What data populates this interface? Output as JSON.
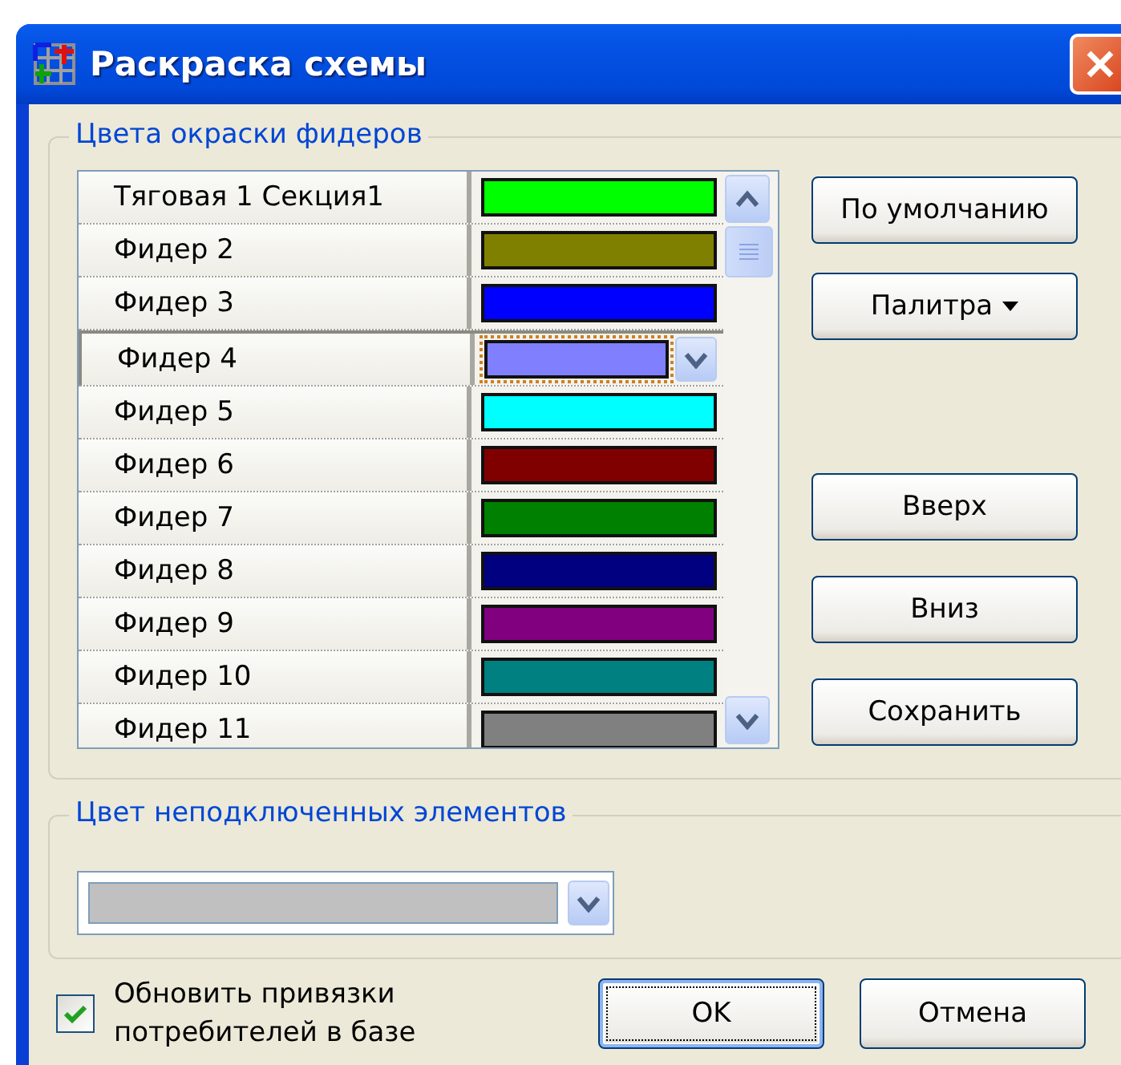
{
  "window": {
    "title": "Раскраска схемы"
  },
  "feeder_group": {
    "title": "Цвета окраски фидеров",
    "rows": [
      {
        "name": "Тяговая 1 Секция1",
        "color": "#00ff00",
        "selected": false
      },
      {
        "name": "Фидер 2",
        "color": "#808000",
        "selected": false
      },
      {
        "name": "Фидер 3",
        "color": "#0000ff",
        "selected": false
      },
      {
        "name": "Фидер 4",
        "color": "#8080ff",
        "selected": true
      },
      {
        "name": "Фидер 5",
        "color": "#00ffff",
        "selected": false
      },
      {
        "name": "Фидер 6",
        "color": "#800000",
        "selected": false
      },
      {
        "name": "Фидер 7",
        "color": "#008000",
        "selected": false
      },
      {
        "name": "Фидер 8",
        "color": "#000080",
        "selected": false
      },
      {
        "name": "Фидер 9",
        "color": "#800080",
        "selected": false
      },
      {
        "name": "Фидер 10",
        "color": "#008080",
        "selected": false
      },
      {
        "name": "Фидер 11",
        "color": "#808080",
        "selected": false
      }
    ],
    "buttons": [
      {
        "label": "По умолчанию",
        "kind": "plain"
      },
      {
        "label": "Палитра",
        "kind": "menu"
      },
      {
        "label": "Вверх",
        "kind": "plain"
      },
      {
        "label": "Вниз",
        "kind": "plain"
      },
      {
        "label": "Сохранить",
        "kind": "plain"
      }
    ]
  },
  "unconnected_group": {
    "title": "Цвет неподключенных элементов",
    "color": "#c0c0c0"
  },
  "update_bindings": {
    "label": "Обновить привязки потребителей в базе",
    "checked": true
  },
  "buttons": [
    {
      "label": "OK",
      "default": true
    },
    {
      "label": "Отмена",
      "default": false
    }
  ]
}
